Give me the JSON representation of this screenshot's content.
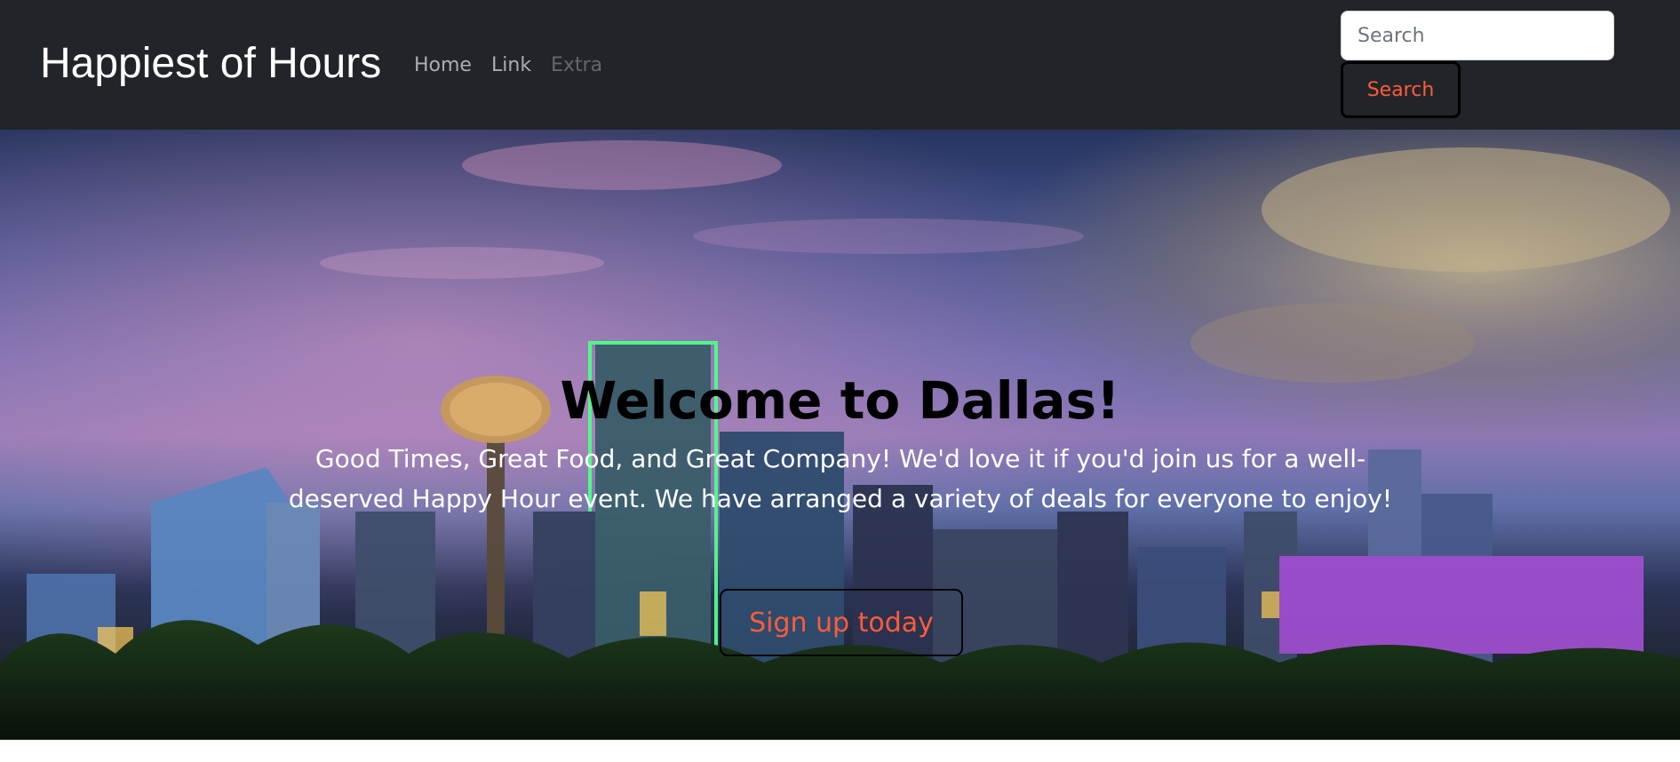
{
  "navbar": {
    "brand": "Happiest of Hours",
    "links": [
      {
        "label": "Home"
      },
      {
        "label": "Link"
      },
      {
        "label": "Extra"
      }
    ],
    "search": {
      "placeholder": "Search",
      "value": "",
      "button_label": "Search"
    }
  },
  "hero": {
    "title": "Welcome to Dallas!",
    "text": "Good Times, Great Food, and Great Company! We'd love it if you'd join us for a well-deserved Happy Hour event. We have arranged a variety of deals for everyone to enjoy!",
    "cta_label": "Sign up today",
    "background": "dallas-skyline-photo"
  },
  "colors": {
    "navbar_bg": "#212529",
    "accent": "#ff5b3a",
    "nav_link": "rgba(255,255,255,0.62)",
    "nav_link_disabled": "rgba(255,255,255,0.30)"
  }
}
